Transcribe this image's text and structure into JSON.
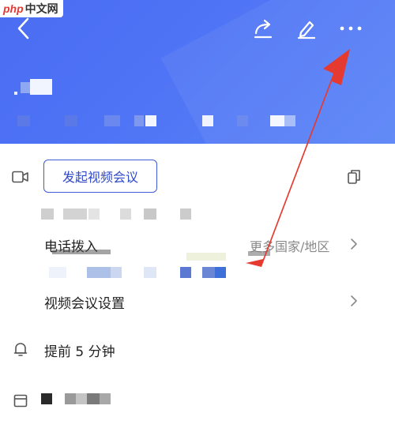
{
  "watermark": {
    "php": "php",
    "cn": "中文网"
  },
  "header": {
    "icons": {
      "back": "chevron-left-icon",
      "share": "share-icon",
      "edit": "pencil-icon",
      "more": "more-horizontal-icon"
    },
    "accent_color": "#4f74f5"
  },
  "meeting": {
    "start_video_button": "发起视频会议",
    "dial_in_label": "电话拨入",
    "more_regions_link": "更多国家/地区",
    "video_settings_label": "视频会议设置",
    "reminder_text": "提前 5 分钟"
  },
  "annotation": {
    "arrow_color": "#e53a2f"
  }
}
